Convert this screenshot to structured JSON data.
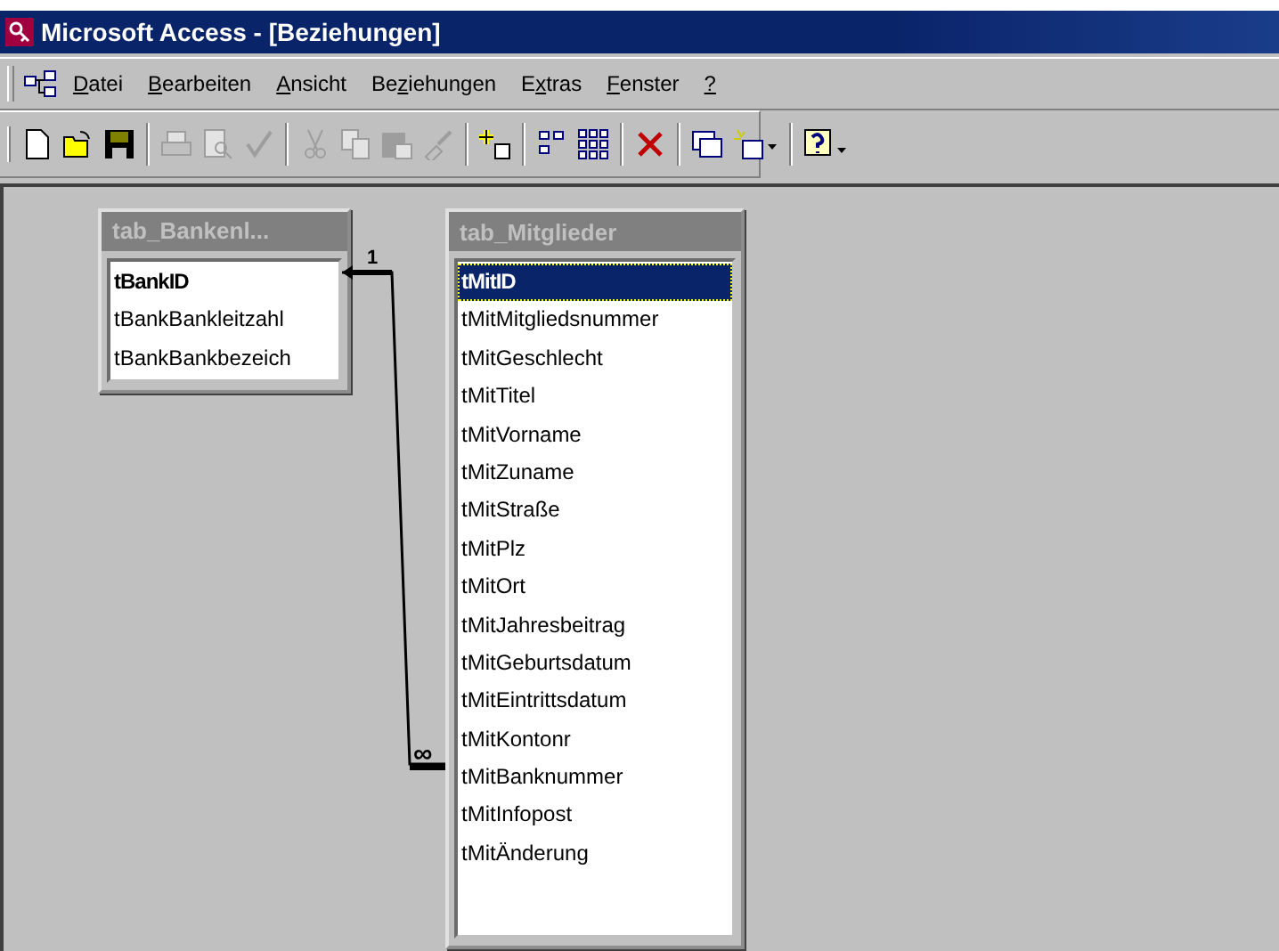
{
  "window": {
    "title": "Microsoft Access - [Beziehungen]"
  },
  "menu": [
    {
      "key": "D",
      "after": "atei"
    },
    {
      "key": "B",
      "after": "earbeiten"
    },
    {
      "key": "A",
      "after": "nsicht"
    },
    {
      "before": "Be",
      "key": "z",
      "after": "iehungen"
    },
    {
      "before": "E",
      "key": "x",
      "after": "tras"
    },
    {
      "key": "F",
      "after": "enster"
    },
    {
      "key": "?"
    }
  ],
  "toolbar": [
    {
      "kind": "new",
      "disabled": false
    },
    {
      "kind": "open",
      "disabled": false
    },
    {
      "kind": "save",
      "disabled": false
    },
    {
      "kind": "separator"
    },
    {
      "kind": "print",
      "disabled": true
    },
    {
      "kind": "preview",
      "disabled": true
    },
    {
      "kind": "spelling",
      "disabled": true
    },
    {
      "kind": "separator"
    },
    {
      "kind": "cut",
      "disabled": true
    },
    {
      "kind": "copy",
      "disabled": true
    },
    {
      "kind": "paste",
      "disabled": true
    },
    {
      "kind": "painter",
      "disabled": true
    },
    {
      "kind": "separator"
    },
    {
      "kind": "show-table",
      "disabled": false
    },
    {
      "kind": "separator"
    },
    {
      "kind": "direct",
      "disabled": false
    },
    {
      "kind": "all",
      "disabled": false
    },
    {
      "kind": "separator"
    },
    {
      "kind": "delete",
      "disabled": false
    },
    {
      "kind": "separator"
    },
    {
      "kind": "db-window",
      "disabled": false
    },
    {
      "kind": "new-object",
      "disabled": false
    },
    {
      "kind": "separator"
    },
    {
      "kind": "help",
      "disabled": false
    }
  ],
  "tables": [
    {
      "title": "tab_Bankenl...",
      "active": false,
      "fields": [
        {
          "name": "tBankID",
          "key": true,
          "selected": false
        },
        {
          "name": "tBankBankleitzahl",
          "key": false,
          "selected": false
        },
        {
          "name": "tBankBankbezeich",
          "key": false,
          "selected": false
        }
      ]
    },
    {
      "title": "tab_Mitglieder",
      "active": false,
      "fields": [
        {
          "name": "tMitID",
          "key": true,
          "selected": true
        },
        {
          "name": "tMitMitgliedsnummer",
          "key": false,
          "selected": false
        },
        {
          "name": "tMitGeschlecht",
          "key": false,
          "selected": false
        },
        {
          "name": "tMitTitel",
          "key": false,
          "selected": false
        },
        {
          "name": "tMitVorname",
          "key": false,
          "selected": false
        },
        {
          "name": "tMitZuname",
          "key": false,
          "selected": false
        },
        {
          "name": "tMitStraße",
          "key": false,
          "selected": false
        },
        {
          "name": "tMitPlz",
          "key": false,
          "selected": false
        },
        {
          "name": "tMitOrt",
          "key": false,
          "selected": false
        },
        {
          "name": "tMitJahresbeitrag",
          "key": false,
          "selected": false
        },
        {
          "name": "tMitGeburtsdatum",
          "key": false,
          "selected": false
        },
        {
          "name": "tMitEintrittsdatum",
          "key": false,
          "selected": false
        },
        {
          "name": "tMitKontonr",
          "key": false,
          "selected": false
        },
        {
          "name": "tMitBanknummer",
          "key": false,
          "selected": false
        },
        {
          "name": "tMitInfopost",
          "key": false,
          "selected": false
        },
        {
          "name": "tMitÄnderung",
          "key": false,
          "selected": false
        }
      ]
    }
  ],
  "relationship": {
    "one_label": "1",
    "many_label": "∞"
  }
}
